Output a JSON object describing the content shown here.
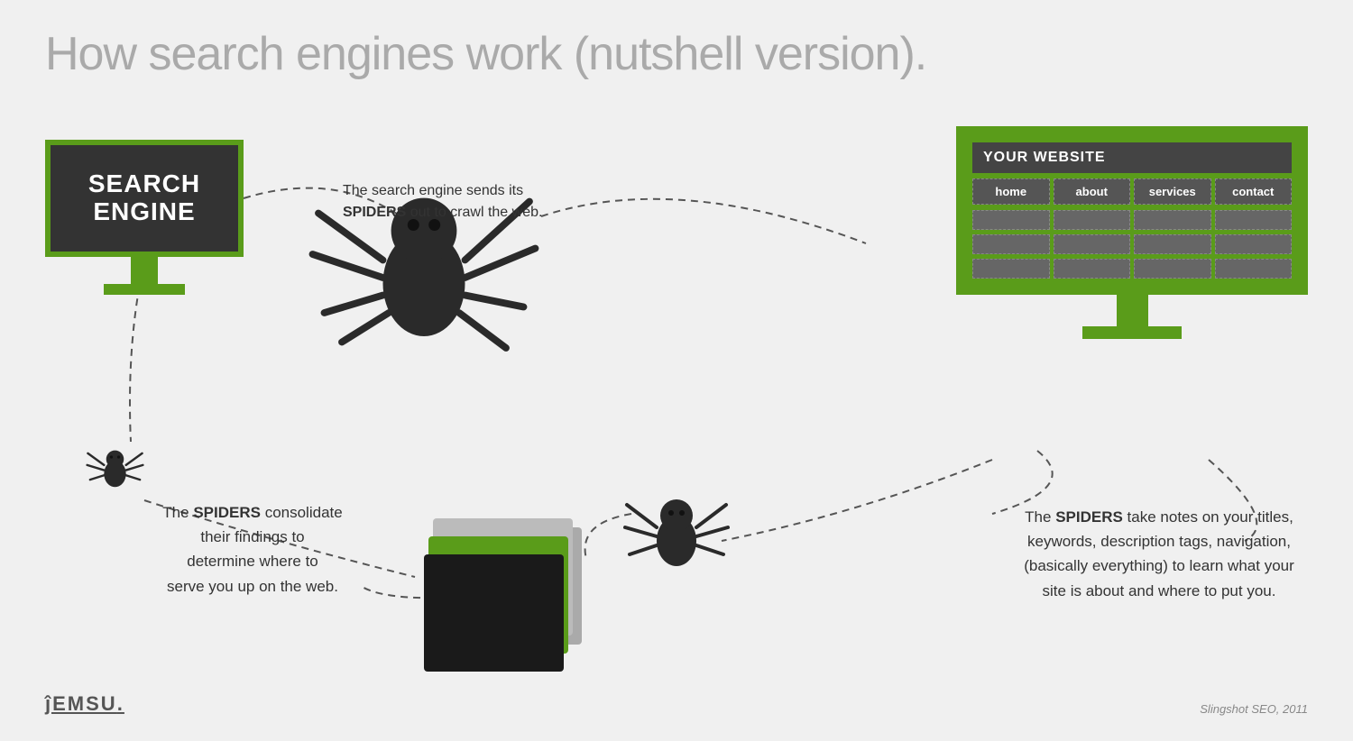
{
  "title": "How search engines work (nutshell version).",
  "search_engine_monitor": {
    "label_line1": "SEARCH",
    "label_line2": "ENGINE"
  },
  "website_monitor": {
    "title": "YOUR WEBSITE",
    "nav_items": [
      "home",
      "about",
      "services",
      "contact"
    ]
  },
  "annotations": {
    "top": "The search engine sends its\nSPIDERS out to crawl the web.",
    "bottom_left": "The SPIDERS consolidate\ntheir findings to\ndetermine where to\nserve you up on the web.",
    "bottom_right": "The SPIDERS take notes on your titles,\nkeywords, description tags, navigation,\n(basically everything) to learn what your\nsite is about and where to put you."
  },
  "logo": {
    "text": "JEMSU"
  },
  "credit": "Slingshot SEO, 2011",
  "colors": {
    "green": "#5a9c1a",
    "dark": "#333333",
    "text": "#444444"
  }
}
